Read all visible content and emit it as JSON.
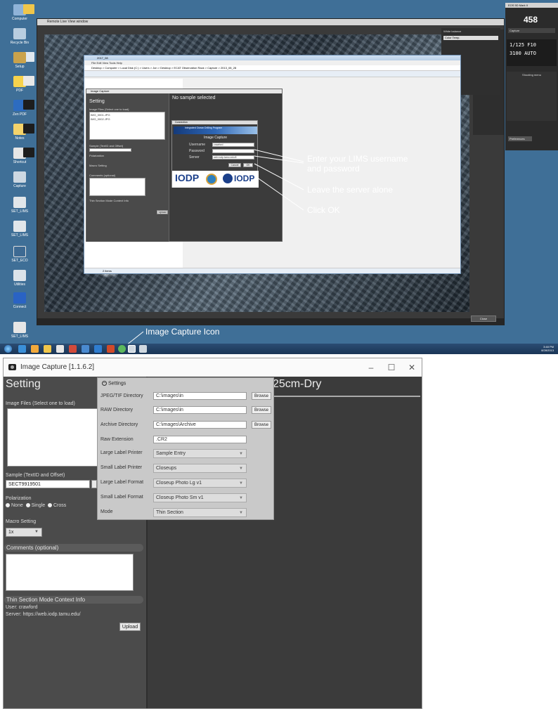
{
  "top_screenshot": {
    "desktop_icons": [
      {
        "label": "Computer"
      },
      {
        "label": "Recycle Bin"
      },
      {
        "label": "Setup"
      },
      {
        "label": "PDF"
      },
      {
        "label": "Zen PDF"
      },
      {
        "label": "Notes"
      },
      {
        "label": "Shortcut"
      },
      {
        "label": "Capture"
      },
      {
        "label": "SET_LIMS"
      },
      {
        "label": "SET_LIMS"
      },
      {
        "label": "SET_ECO"
      },
      {
        "label": "Utilities"
      },
      {
        "label": "Connect"
      },
      {
        "label": "SET_LIMS"
      }
    ],
    "live_view_title": "Remote Live View window",
    "explorer": {
      "title": "2017_08",
      "menu": "File  Edit  View  Tools  Help",
      "address": "Desktop > Computer > Local Disk (C:) > Users > Jon > Desktop > ECAT Observation Rack > Capture > 2013_08_28",
      "status": "2 items"
    },
    "image_capture_small": {
      "title": "Image Capture",
      "setting": "Setting",
      "no_sample": "No sample selected",
      "image_files_label": "Image Files (Select one to load)",
      "files": [
        "IMG_0001.JPG",
        "IMG_0002.JPG"
      ],
      "sample_label": "Sample (TextID and Offset)",
      "polarization_label": "Polarization",
      "macro_label": "Macro Setting",
      "comments_label": "Comments (optional)",
      "info_label": "Thin Section Mode Context Info",
      "upload": "Upload"
    },
    "login_dialog": {
      "window_title": "Connection",
      "banner": "Integrated Ocean Drilling Program",
      "title": "Image Capture",
      "username_label": "Username",
      "password_label": "Password",
      "server_label": "Server",
      "username_value": "crawford",
      "server_value": "web.iodp.tamu.edu:8",
      "cancel": "Cancel",
      "ok": "OK",
      "logo_left": "IODP",
      "logo_right": "IODP"
    },
    "annotations": {
      "enter_creds": "Enter your LIMS username\nand password",
      "leave_server": "Leave the server alone",
      "click_ok": "Click OK",
      "image_capture_icon": "Image Capture Icon"
    },
    "camera": {
      "title": "EOS 5D Mark II",
      "shots": "458",
      "mode": "Capture",
      "shutter_aperture": "1/125  F10",
      "iso": "3100 AUTO",
      "shooting_menu": "Shooting menu",
      "preferences": "Preferences"
    },
    "whitebalance": {
      "title": "White balance",
      "mode": "Color Temp."
    },
    "close": "Close",
    "clock": {
      "time": "3:48 PM",
      "date": "8/28/2013"
    }
  },
  "bottom_app": {
    "title": "Image Capture [1.1.6.2]",
    "setting": "Setting",
    "right_title": "25cm-Dry",
    "image_files_label": "Image Files (Select one to load)",
    "sample_label": "Sample (TextID and Offset)",
    "sample_value": "SECT9919501",
    "polarization_label": "Polarization",
    "polarization_options": [
      "None",
      "Single",
      "Cross"
    ],
    "macro_label": "Macro Setting",
    "macro_value": "1x",
    "comments_label": "Comments (optional)",
    "info_label": "Thin Section Mode Context Info",
    "user_line": "User: crawford",
    "server_line": "Server: https://web.iodp.tamu.edu/",
    "upload": "Upload",
    "settings_popup": {
      "header": "Settings",
      "rows": [
        {
          "label": "JPEG/TIF Directory",
          "value": "C:\\images\\in",
          "browse": "Browse"
        },
        {
          "label": "RAW Directory",
          "value": "C:\\images\\in",
          "browse": "Browse"
        },
        {
          "label": "Archive Directory",
          "value": "C:\\images\\Archive",
          "browse": "Browse"
        }
      ],
      "raw_ext_label": "Raw Extension",
      "raw_ext_value": ".CR2",
      "selects": [
        {
          "label": "Large Label Printer",
          "value": "Sample Entry"
        },
        {
          "label": "Small Label Printer",
          "value": "Closeups"
        },
        {
          "label": "Large Label Format",
          "value": "Closeup Photo Lg v1"
        },
        {
          "label": "Small Label Format",
          "value": "Closeup Photo Sm v1"
        },
        {
          "label": "Mode",
          "value": "Thin Section"
        }
      ]
    }
  }
}
